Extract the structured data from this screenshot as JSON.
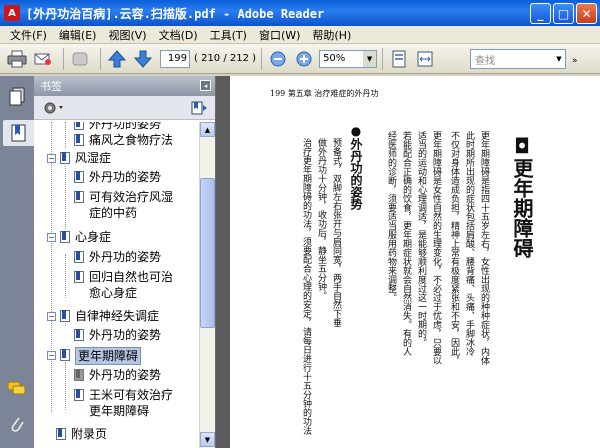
{
  "window": {
    "title": "[外丹功治百病].云容.扫描版.pdf - Adobe Reader",
    "minimize": "_",
    "maximize": "□",
    "close": "✕"
  },
  "menu": [
    "文件(F)",
    "编辑(E)",
    "视图(V)",
    "文档(D)",
    "工具(T)",
    "窗口(W)",
    "帮助(H)"
  ],
  "toolbar": {
    "current_page": "199",
    "page_count": "( 210 / 212 )",
    "zoom": "50%",
    "search_placeholder": "查找",
    "more": "»"
  },
  "panel": {
    "title": "书签",
    "collapse": "◂"
  },
  "bookmarks": [
    {
      "label": "外丹功的姿势",
      "level": 2
    },
    {
      "label": "痛风之食物疗法",
      "level": 2
    },
    {
      "label": "风湿症",
      "level": 1,
      "expander": "−"
    },
    {
      "label": "外丹功的姿势",
      "level": 2
    },
    {
      "label": "可有效治疗风湿症的中药",
      "level": 2,
      "lines": [
        "可有效治疗风湿",
        "症的中药"
      ]
    },
    {
      "label": "心身症",
      "level": 1,
      "expander": "−"
    },
    {
      "label": "外丹功的姿势",
      "level": 2
    },
    {
      "label": "回归自然也可治愈心身症",
      "level": 2,
      "lines": [
        "回归自然也可治",
        "愈心身症"
      ]
    },
    {
      "label": "自律神经失调症",
      "level": 1,
      "expander": "−"
    },
    {
      "label": "外丹功的姿势",
      "level": 2
    },
    {
      "label": "更年期障碍",
      "level": 1,
      "expander": "−",
      "selected": true
    },
    {
      "label": "外丹功的姿势",
      "level": 2,
      "gray": true
    },
    {
      "label": "王米可有效治疗更年期障碍",
      "level": 2,
      "lines": [
        "王米可有效治疗",
        "更年期障碍"
      ]
    },
    {
      "label": "附录页",
      "level": 0
    }
  ],
  "document": {
    "header": "199 第五章 治疗难症的外丹功",
    "chapter_title": "◘更年期障碍",
    "section_title": "●外丹功的姿势",
    "columns": [
      "更年期障碍是指四十五岁左右，女性出现的种种症状，内体",
      "此时期所出现的症状包括肩酸、腰背痛、头痛、手脚冰冷",
      "不仅对身体造成负担，精神上常有极度紧张和不安，因此，",
      "更年期障碍是女性自然的生理变化，不必过于忧虑，只要以",
      "适当的运动和心理调适，是能够顺利度过这一时期的。",
      "若能配合正确的饮食，更年期症状就会自然消失。有的人",
      "经医师的诊断，须要适当服用药物来调整。",
      "预备式，双脚左右张开与肩同宽，两手自然下垂",
      "做外丹功十分钟，收功后，静坐五分钟。",
      "治疗更年期障碍的功法，须要配合心理的安定，请每日进行十五分钟的功法"
    ]
  }
}
